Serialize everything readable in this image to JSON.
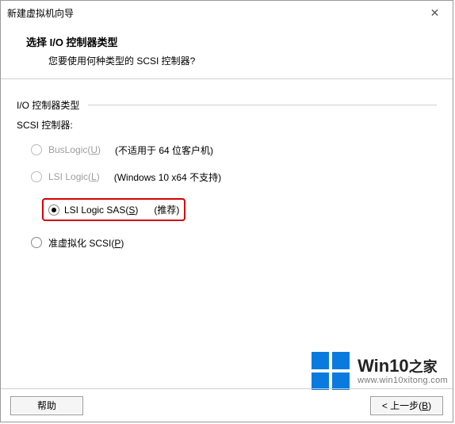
{
  "window": {
    "title": "新建虚拟机向导"
  },
  "header": {
    "title": "选择 I/O 控制器类型",
    "subtitle": "您要使用何种类型的 SCSI 控制器?"
  },
  "group": {
    "legend": "I/O 控制器类型",
    "scsi_label": "SCSI 控制器:"
  },
  "options": {
    "buslogic": {
      "label_pre": "BusLogic(",
      "accel": "U",
      "label_post": ")",
      "note": "(不适用于 64 位客户机)",
      "enabled": false,
      "selected": false
    },
    "lsilogic": {
      "label_pre": "LSI Logic(",
      "accel": "L",
      "label_post": ")",
      "note": "(Windows 10 x64 不支持)",
      "enabled": false,
      "selected": false
    },
    "lsilogic_sas": {
      "label_pre": "LSI Logic SAS(",
      "accel": "S",
      "label_post": ")",
      "note": "(推荐)",
      "enabled": true,
      "selected": true
    },
    "paravirtual": {
      "label_pre": "准虚拟化 SCSI(",
      "accel": "P",
      "label_post": ")",
      "note": "",
      "enabled": true,
      "selected": false
    }
  },
  "buttons": {
    "help": "帮助",
    "back_pre": "< 上一步(",
    "back_accel": "B",
    "back_post": ")"
  },
  "watermark": {
    "brand_main": "Win10",
    "brand_suffix": "之家",
    "url": "www.win10xitong.com"
  }
}
